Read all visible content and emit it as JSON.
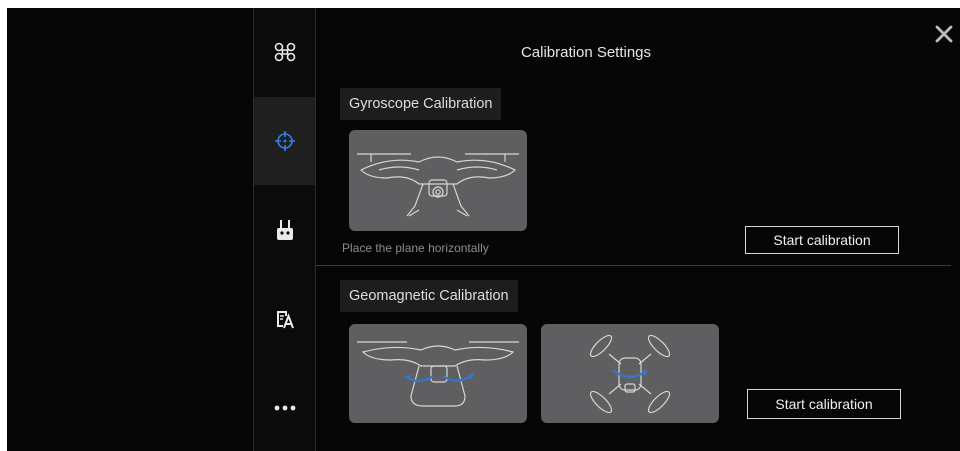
{
  "header": {
    "title": "Calibration Settings"
  },
  "sidebar": {
    "items": [
      {
        "icon": "drone-icon"
      },
      {
        "icon": "crosshair-icon",
        "active": true,
        "accent": "#2f80ed"
      },
      {
        "icon": "remote-controller-icon"
      },
      {
        "icon": "language-icon"
      },
      {
        "icon": "more-icon"
      }
    ]
  },
  "gyroscope": {
    "label": "Gyroscope Calibration",
    "hint": "Place the plane horizontally",
    "button": "Start calibration"
  },
  "geomagnetic": {
    "label": "Geomagnetic Calibration",
    "button": "Start calibration"
  },
  "colors": {
    "background": "#060606",
    "card": "#5f5f61",
    "accent": "#2f80ed",
    "rotation_arrow": "#3a74c4"
  }
}
